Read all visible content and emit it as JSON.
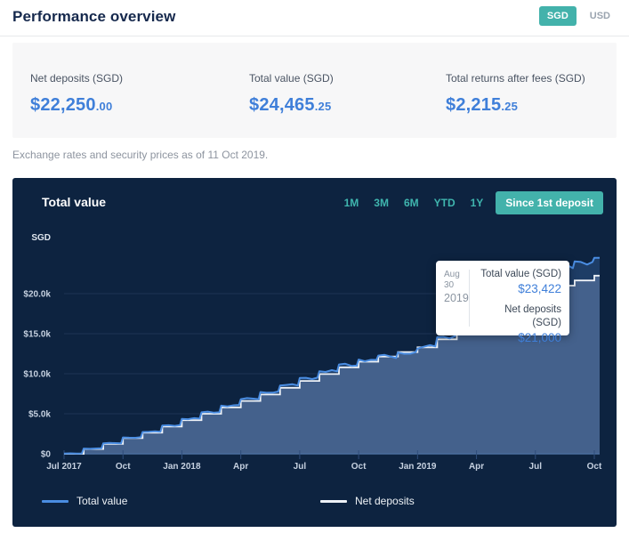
{
  "header": {
    "title": "Performance overview",
    "currency_options": [
      "SGD",
      "USD"
    ],
    "selected_currency": "SGD"
  },
  "stats": [
    {
      "label": "Net deposits (SGD)",
      "whole": "$22,250",
      "fraction": ".00"
    },
    {
      "label": "Total value (SGD)",
      "whole": "$24,465",
      "fraction": ".25"
    },
    {
      "label": "Total returns after fees (SGD)",
      "whole": "$2,215",
      "fraction": ".25"
    }
  ],
  "note": "Exchange rates and security prices as of 11 Oct 2019.",
  "chart_card": {
    "title": "Total value",
    "ranges": [
      "1M",
      "3M",
      "6M",
      "YTD",
      "1Y"
    ],
    "selected_range": "Since 1st deposit",
    "legend": [
      {
        "label": "Total value",
        "color": "#4a8de2"
      },
      {
        "label": "Net deposits",
        "color": "#eef2f7"
      }
    ]
  },
  "tooltip": {
    "date_line1": "Aug 30",
    "date_line2": "2019",
    "rows": [
      {
        "label": "Total value (SGD)",
        "value": "$23,422"
      },
      {
        "label": "Net deposits (SGD)",
        "value": "$21,000"
      }
    ]
  },
  "chart_data": {
    "type": "area",
    "title": "Total value",
    "unit_label": "SGD",
    "x": [
      "2017-07",
      "2017-08",
      "2017-09",
      "2017-10",
      "2017-11",
      "2017-12",
      "2018-01",
      "2018-02",
      "2018-03",
      "2018-04",
      "2018-05",
      "2018-06",
      "2018-07",
      "2018-08",
      "2018-09",
      "2018-10",
      "2018-11",
      "2018-12",
      "2019-01",
      "2019-02",
      "2019-03",
      "2019-04",
      "2019-05",
      "2019-06",
      "2019-07",
      "2019-08",
      "2019-09",
      "2019-10"
    ],
    "series": [
      {
        "name": "Total value",
        "color": "#4a8de2",
        "values": [
          20,
          650,
          1320,
          2030,
          2740,
          3520,
          4380,
          5180,
          6000,
          6850,
          7680,
          8560,
          9440,
          10330,
          11150,
          11750,
          12300,
          12600,
          13200,
          14500,
          15650,
          16800,
          18000,
          19400,
          21000,
          23422,
          23950,
          24465
        ]
      },
      {
        "name": "Net deposits",
        "color": "#eef2f7",
        "step": true,
        "values": [
          0,
          600,
          1250,
          1950,
          2650,
          3400,
          4200,
          5000,
          5800,
          6600,
          7400,
          8250,
          9100,
          9950,
          10800,
          11500,
          12150,
          12700,
          13300,
          14300,
          15300,
          16350,
          17450,
          18650,
          19800,
          21000,
          21650,
          22250
        ]
      }
    ],
    "x_ticks": [
      {
        "label": "Jul 2017",
        "index": 0
      },
      {
        "label": "Oct",
        "index": 3
      },
      {
        "label": "Jan 2018",
        "index": 6
      },
      {
        "label": "Apr",
        "index": 9
      },
      {
        "label": "Jul",
        "index": 12
      },
      {
        "label": "Oct",
        "index": 15
      },
      {
        "label": "Jan 2019",
        "index": 18
      },
      {
        "label": "Apr",
        "index": 21
      },
      {
        "label": "Jul",
        "index": 24
      },
      {
        "label": "Oct",
        "index": 27
      }
    ],
    "y_ticks": [
      {
        "label": "$0",
        "value": 0
      },
      {
        "label": "$5.0k",
        "value": 5000
      },
      {
        "label": "$10.0k",
        "value": 10000
      },
      {
        "label": "$15.0k",
        "value": 15000
      },
      {
        "label": "$20.0k",
        "value": 20000
      }
    ],
    "ylim": [
      0,
      26000
    ],
    "grid": true,
    "legend_position": "bottom"
  },
  "colors": {
    "accent_teal": "#43b2ab",
    "value_blue": "#3f7fd9",
    "card_background": "#0d2340",
    "fill_total_only": "#1e3d66",
    "fill_deposits_overlap": "#44618c",
    "gridline": "#1d3355",
    "axis_line": "#4b6e9d",
    "axis_label": "#c6d1e0"
  }
}
